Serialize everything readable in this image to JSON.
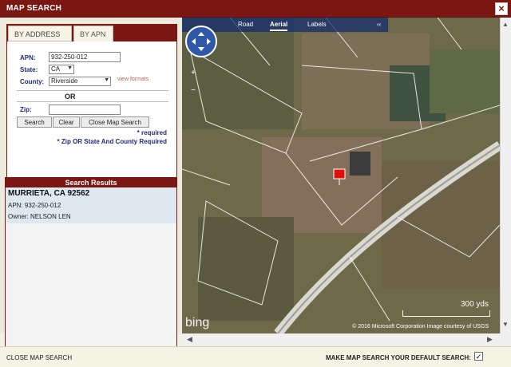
{
  "window": {
    "title": "MAP SEARCH",
    "close_glyph": "×"
  },
  "tabs": [
    {
      "label": "BY ADDRESS"
    },
    {
      "label": "BY APN"
    }
  ],
  "form": {
    "apn_label": "APN:",
    "apn_value": "932-250-012",
    "state_label": "State:",
    "state_value": "CA",
    "county_label": "County:",
    "county_value": "Riverside",
    "view_formats": "view formats",
    "or": "OR",
    "zip_label": "Zip:",
    "zip_value": "",
    "buttons": {
      "search": "Search",
      "clear": "Clear",
      "close_map_search": "Close Map Search"
    },
    "required_note": "* required",
    "zip_note": "* Zip OR State And County Required"
  },
  "results": {
    "header": "Search Results",
    "items": [
      {
        "city": "MURRIETA, CA  92562",
        "apn": "APN: 932-250-012",
        "owner": "Owner: NELSON LEN"
      }
    ]
  },
  "map": {
    "tabs": [
      {
        "label": "Road",
        "active": false
      },
      {
        "label": "Aerial",
        "active": true
      },
      {
        "label": "Labels",
        "active": false
      }
    ],
    "collapse_glyph": "‹‹",
    "zoom_in": "+",
    "zoom_out": "−",
    "scale": "300 yds",
    "copyright": "© 2016 Microsoft Corporation   Image courtesy of USGS",
    "bing_logo": "bing"
  },
  "footer": {
    "close_link": "CLOSE MAP SEARCH",
    "default_label": "MAKE MAP SEARCH YOUR DEFAULT SEARCH:",
    "default_checked": true,
    "check_glyph": "✓"
  },
  "colors": {
    "accent": "#7b1712",
    "label_blue": "#1d2a7a"
  }
}
